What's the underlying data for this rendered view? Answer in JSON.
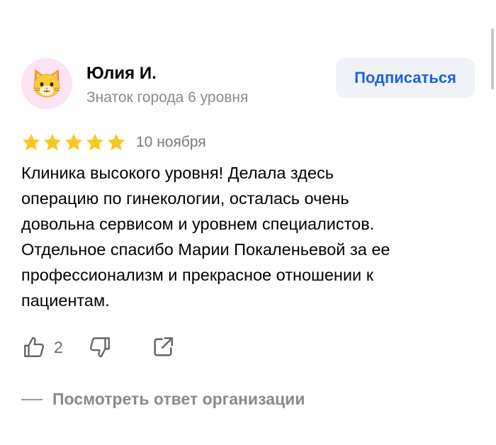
{
  "author": {
    "name": "Юлия И.",
    "level": "Знаток города 6 уровня",
    "avatar_icon": "cat-face-icon"
  },
  "subscribe_button": {
    "label": "Подписаться"
  },
  "review": {
    "rating": 5,
    "rating_max": 5,
    "date": "10 ноября",
    "text_lines": [
      "Клиника высокого уровня! Делала здесь",
      "операцию по гинекологии, осталась очень",
      "довольна сервисом и уровнем специалистов.",
      "Отдельное спасибо Марии Покаленьевой за ее",
      "профессионализм и прекрасное отношении к",
      "пациентам."
    ]
  },
  "actions": {
    "like_icon": "thumbs-up-icon",
    "like_count": "2",
    "dislike_icon": "thumbs-down-icon",
    "share_icon": "share-icon"
  },
  "org_answer": {
    "label": "Посмотреть ответ организации"
  },
  "colors": {
    "accent": "#1a63d8",
    "star": "#fcc521",
    "muted_text": "#8a8a8a",
    "button_bg": "#eff2f7",
    "avatar_bg": "#fbe3f3"
  }
}
